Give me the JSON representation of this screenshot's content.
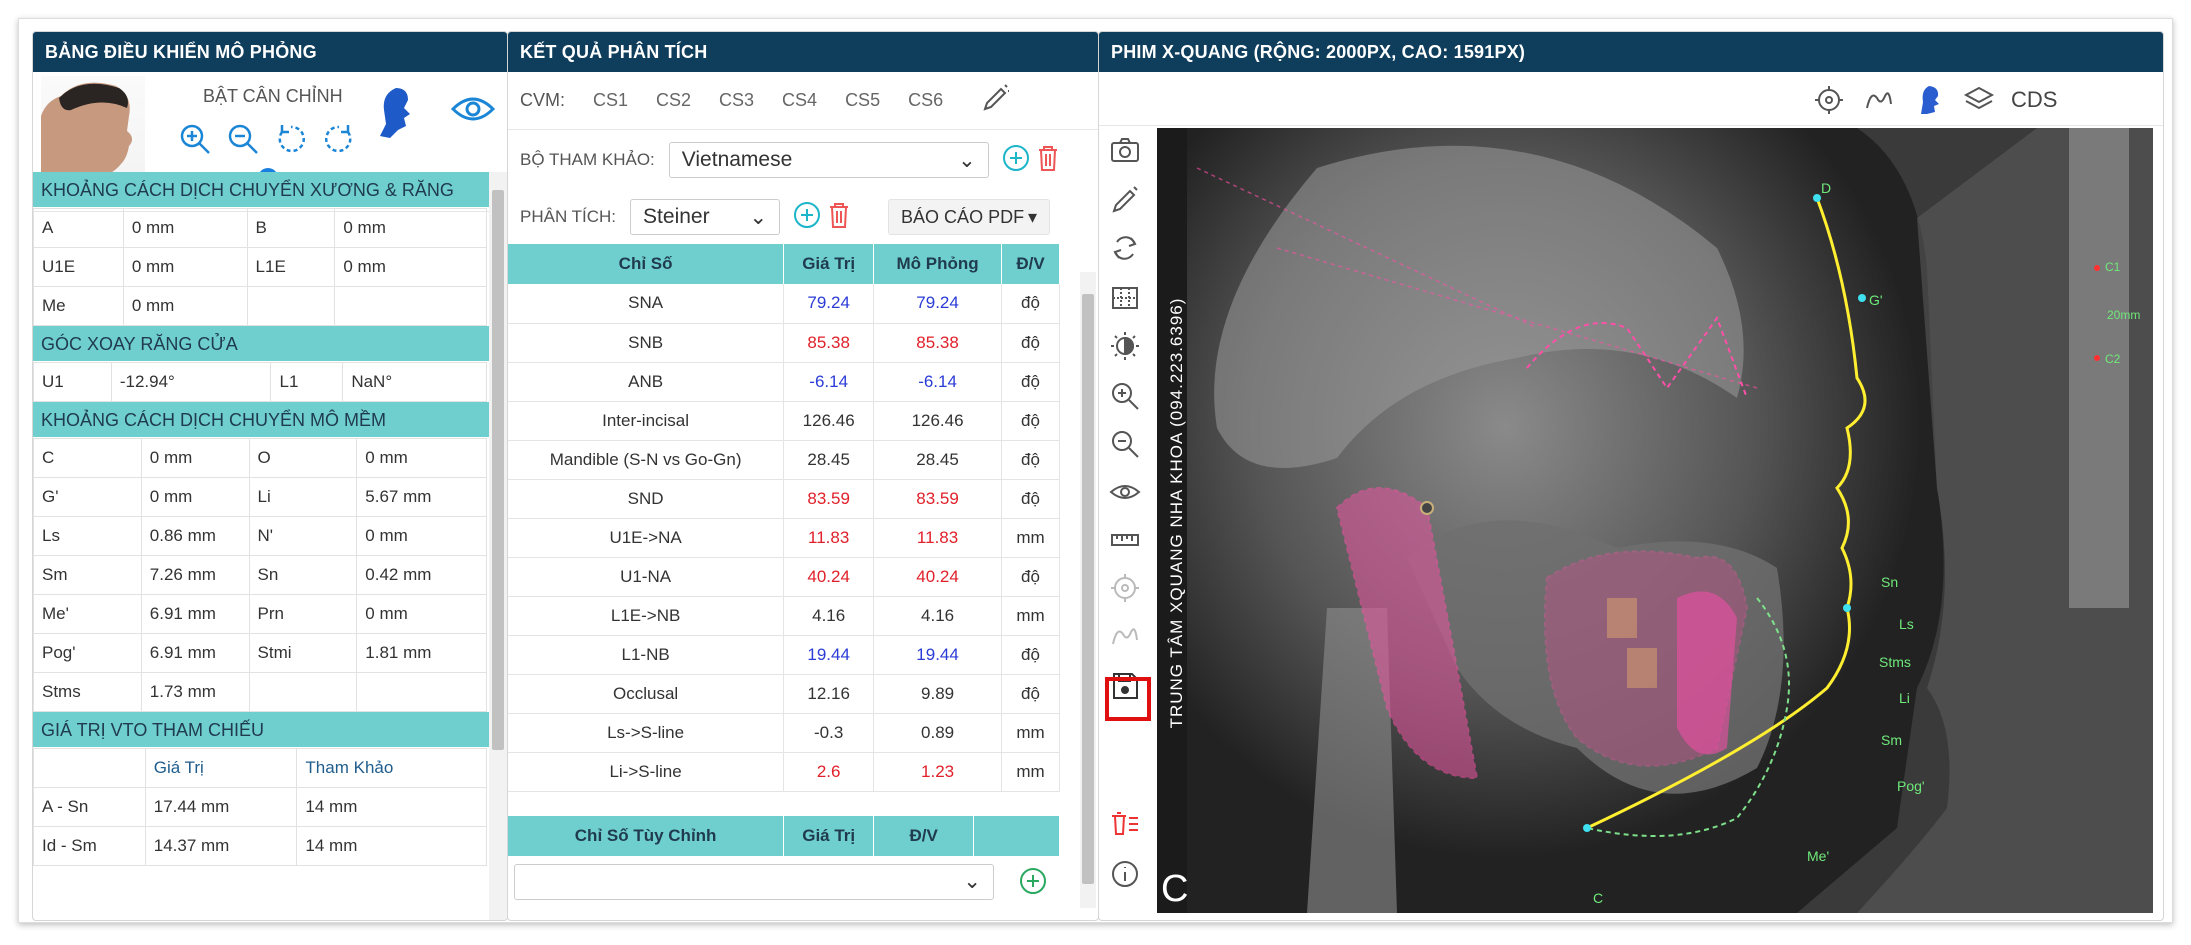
{
  "left_panel": {
    "title": "BẢNG ĐIỀU KHIỂN MÔ PHỎNG",
    "calibrate_label": "BẬT CÂN CHỈNH",
    "slider_value": 0.3,
    "bone_section": {
      "title": "KHOẢNG CÁCH DỊCH CHUYỂN XƯƠNG & RĂNG",
      "rows": [
        {
          "k1": "A",
          "v1": "0 mm",
          "k2": "B",
          "v2": "0 mm"
        },
        {
          "k1": "U1E",
          "v1": "0 mm",
          "k2": "L1E",
          "v2": "0 mm"
        },
        {
          "k1": "Me",
          "v1": "0 mm",
          "k2": "",
          "v2": ""
        }
      ]
    },
    "rotation_section": {
      "title": "GÓC XOAY RĂNG CỬA",
      "rows": [
        {
          "k1": "U1",
          "v1": "-12.94°",
          "k2": "L1",
          "v2": "NaN°"
        }
      ]
    },
    "soft_section": {
      "title": "KHOẢNG CÁCH DỊCH CHUYỂN MÔ MỀM",
      "rows": [
        {
          "k1": "C",
          "v1": "0 mm",
          "k2": "O",
          "v2": "0 mm"
        },
        {
          "k1": "G'",
          "v1": "0 mm",
          "k2": "Li",
          "v2": "5.67 mm"
        },
        {
          "k1": "Ls",
          "v1": "0.86 mm",
          "k2": "N'",
          "v2": "0 mm"
        },
        {
          "k1": "Sm",
          "v1": "7.26 mm",
          "k2": "Sn",
          "v2": "0.42 mm"
        },
        {
          "k1": "Me'",
          "v1": "6.91 mm",
          "k2": "Prn",
          "v2": "0 mm"
        },
        {
          "k1": "Pog'",
          "v1": "6.91 mm",
          "k2": "Stmi",
          "v2": "1.81 mm"
        },
        {
          "k1": "Stms",
          "v1": "1.73 mm",
          "k2": "",
          "v2": ""
        }
      ]
    },
    "vto_section": {
      "title": "GIÁ TRỊ VTO THAM CHIẾU",
      "col_value": "Giá Trị",
      "col_ref": "Tham Khảo",
      "rows": [
        {
          "k": "A - Sn",
          "v": "17.44 mm",
          "r": "14 mm"
        },
        {
          "k": "Id - Sm",
          "v": "14.37 mm",
          "r": "14 mm"
        }
      ]
    }
  },
  "middle_panel": {
    "title": "KẾT QUẢ PHÂN TÍCH",
    "cvm_label": "CVM:",
    "cvm_stages": [
      "CS1",
      "CS2",
      "CS3",
      "CS4",
      "CS5",
      "CS6"
    ],
    "ref_label": "BỘ THAM KHẢO:",
    "ref_value": "Vietnamese",
    "analysis_label": "PHÂN TÍCH:",
    "analysis_value": "Steiner",
    "report_button": "BÁO CÁO PDF",
    "columns": [
      "Chỉ Số",
      "Giá Trị",
      "Mô Phỏng",
      "Đ/V"
    ],
    "rows": [
      {
        "name": "SNA",
        "value": "79.24",
        "sim": "79.24",
        "unit": "độ",
        "color": "blue"
      },
      {
        "name": "SNB",
        "value": "85.38",
        "sim": "85.38",
        "unit": "độ",
        "color": "red"
      },
      {
        "name": "ANB",
        "value": "-6.14",
        "sim": "-6.14",
        "unit": "độ",
        "color": "blue"
      },
      {
        "name": "Inter-incisal",
        "value": "126.46",
        "sim": "126.46",
        "unit": "độ",
        "color": ""
      },
      {
        "name": "Mandible (S-N vs Go-Gn)",
        "value": "28.45",
        "sim": "28.45",
        "unit": "độ",
        "color": ""
      },
      {
        "name": "SND",
        "value": "83.59",
        "sim": "83.59",
        "unit": "độ",
        "color": "red"
      },
      {
        "name": "U1E->NA",
        "value": "11.83",
        "sim": "11.83",
        "unit": "mm",
        "color": "red"
      },
      {
        "name": "U1-NA",
        "value": "40.24",
        "sim": "40.24",
        "unit": "độ",
        "color": "red"
      },
      {
        "name": "L1E->NB",
        "value": "4.16",
        "sim": "4.16",
        "unit": "mm",
        "color": ""
      },
      {
        "name": "L1-NB",
        "value": "19.44",
        "sim": "19.44",
        "unit": "độ",
        "color": "blue"
      },
      {
        "name": "Occlusal",
        "value": "12.16",
        "sim": "9.89",
        "unit": "độ",
        "color": ""
      },
      {
        "name": "Ls->S-line",
        "value": "-0.3",
        "sim": "0.89",
        "unit": "mm",
        "color": ""
      },
      {
        "name": "Li->S-line",
        "value": "2.6",
        "sim": "1.23",
        "unit": "mm",
        "color": "red"
      }
    ],
    "custom_columns": [
      "Chỉ Số Tùy Chỉnh",
      "Giá Trị",
      "Đ/V"
    ]
  },
  "right_panel": {
    "title": "PHIM X-QUANG (RỘNG: 2000PX, CAO: 1591PX)",
    "cds_label": "CDS",
    "xray_caption": "TRUNG TÂM XQUANG NHA KHOA (094.223.6396)",
    "corner_letter": "C",
    "landmarks": [
      "D",
      "G'",
      "C1",
      "20mm",
      "C2",
      "Sn",
      "Ls",
      "Stms",
      "Li",
      "Sm",
      "Pog'",
      "Me'",
      "C"
    ]
  }
}
